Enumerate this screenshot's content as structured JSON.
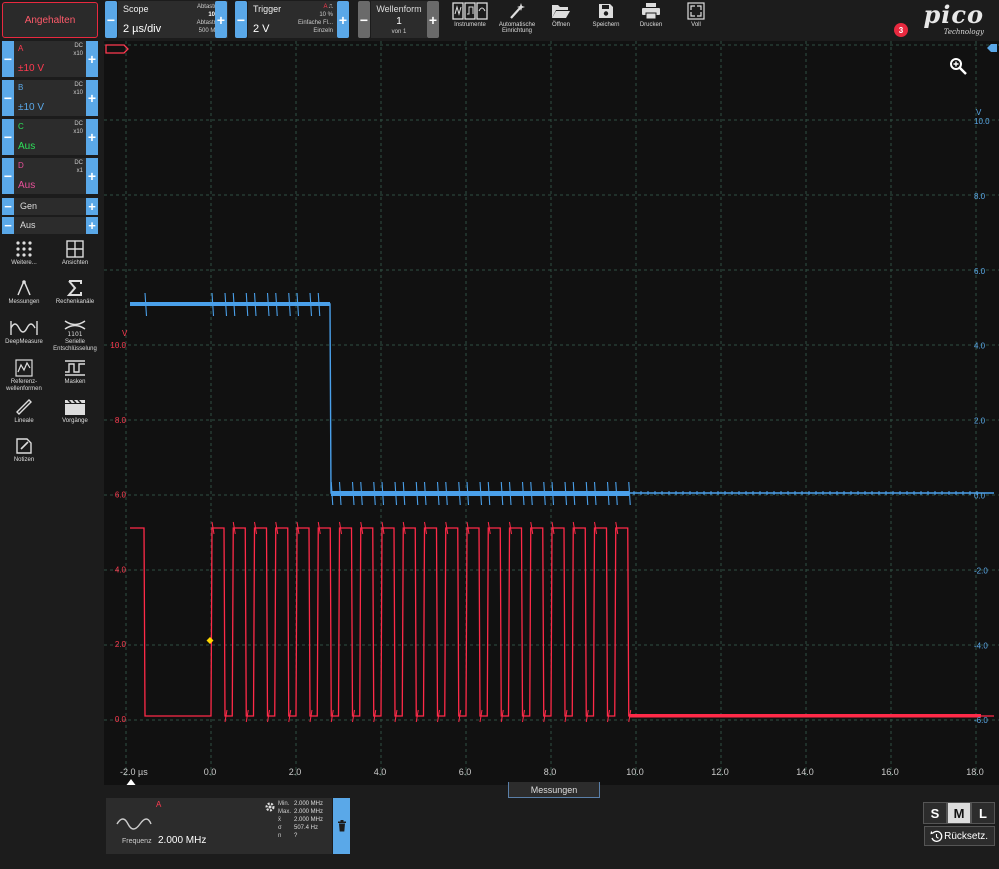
{
  "toolbar": {
    "run_state": "Angehalten",
    "scope": {
      "title": "Scope",
      "timebase": "2 µs/div",
      "sampling_label": "Abtastung",
      "sampling_value": "10 kS",
      "rate_label": "Abtastrate",
      "rate_value": "500 MS/s"
    },
    "trigger": {
      "title": "Trigger",
      "level": "2 V",
      "channel": "A",
      "position": "10 %",
      "type": "Einfache Fl...",
      "mode": "Einzeln"
    },
    "waveform": {
      "title": "Wellenform",
      "index": "1",
      "of": "von 1"
    },
    "buttons": {
      "instruments": "Instrumente",
      "auto_setup_1": "Automatische",
      "auto_setup_2": "Einrichtung",
      "open": "Öffnen",
      "save": "Speichern",
      "print": "Drucken",
      "full": "Voll"
    },
    "logo": {
      "name": "pico",
      "sub": "Technology",
      "notifications": "3"
    }
  },
  "channels": [
    {
      "name": "A",
      "coupling": "DC",
      "probe": "x10",
      "range": "±10 V",
      "color": "#ff3a50"
    },
    {
      "name": "B",
      "coupling": "DC",
      "probe": "x10",
      "range": "±10 V",
      "color": "#5aa8e8"
    },
    {
      "name": "C",
      "coupling": "DC",
      "probe": "x10",
      "range": "Aus",
      "color": "#2ee05a"
    },
    {
      "name": "D",
      "coupling": "DC",
      "probe": "x1",
      "range": "Aus",
      "color": "#e8509a"
    }
  ],
  "generator": {
    "label": "Gen",
    "state": "Aus"
  },
  "tools": [
    {
      "label1": "Weitere...",
      "label2": ""
    },
    {
      "label1": "Ansichten",
      "label2": ""
    },
    {
      "label1": "Messungen",
      "label2": ""
    },
    {
      "label1": "Rechenkanäle",
      "label2": ""
    },
    {
      "label1": "DeepMeasure",
      "label2": ""
    },
    {
      "label1": "Serielle",
      "label2": "Entschlüsselung"
    },
    {
      "label1": "Referenz-",
      "label2": "wellenformen"
    },
    {
      "label1": "Masken",
      "label2": ""
    },
    {
      "label1": "Lineale",
      "label2": ""
    },
    {
      "label1": "Vorgänge",
      "label2": ""
    },
    {
      "label1": "Notizen",
      "label2": ""
    }
  ],
  "plot": {
    "x_ticks": [
      "-2.0 µs",
      "0.0",
      "2.0",
      "4.0",
      "6.0",
      "8.0",
      "10.0",
      "12.0",
      "14.0",
      "16.0",
      "18.0"
    ],
    "left_axis_unit": "V",
    "left_ticks": [
      "10.0",
      "8.0",
      "6.0",
      "4.0",
      "2.0",
      "0.0",
      "-2.0"
    ],
    "right_axis_unit": "V",
    "right_ticks": [
      "10.0",
      "8.0",
      "6.0",
      "4.0",
      "2.0",
      "0.0",
      "-2.0",
      "-4.0",
      "-6.0",
      "-8.0"
    ]
  },
  "measurements": {
    "tab": "Messungen",
    "channel": "A",
    "label": "Frequenz",
    "value": "2.000 MHz",
    "stats": [
      {
        "k": "Min.",
        "v": "2.000 MHz"
      },
      {
        "k": "Max.",
        "v": "2.000 MHz"
      },
      {
        "k": "x̄",
        "v": "2.000 MHz"
      },
      {
        "k": "σ",
        "v": "507.4 Hz"
      },
      {
        "k": "n",
        "v": "?"
      }
    ]
  },
  "size_buttons": [
    "S",
    "M",
    "L"
  ],
  "reset_label": "Rücksetz."
}
